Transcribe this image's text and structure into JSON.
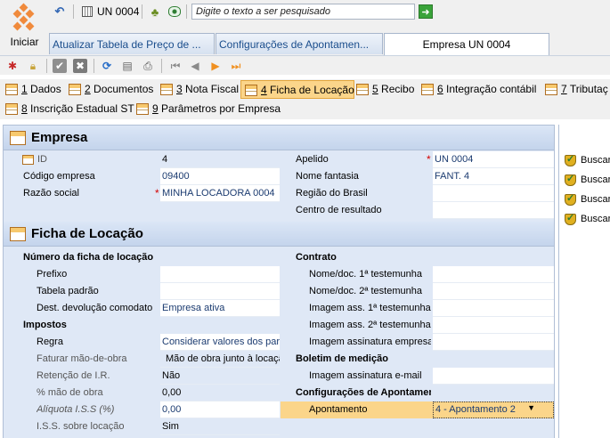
{
  "start": {
    "label": "Iniciar"
  },
  "toolbar": {
    "company_code": "UN 0004",
    "search_placeholder": "Digite o texto a ser pesquisado"
  },
  "tabs": [
    {
      "label": "Atualizar Tabela de Preço de ..."
    },
    {
      "label": "Configurações de Apontamen..."
    },
    {
      "label": "Empresa UN 0004"
    }
  ],
  "sections_nav": [
    {
      "num": "1",
      "label": "Dados"
    },
    {
      "num": "2",
      "label": "Documentos"
    },
    {
      "num": "3",
      "label": "Nota Fiscal"
    },
    {
      "num": "4",
      "label": "Ficha de Locação"
    },
    {
      "num": "5",
      "label": "Recibo"
    },
    {
      "num": "6",
      "label": "Integração contábil"
    },
    {
      "num": "7",
      "label": "Tributaç"
    },
    {
      "num": "8",
      "label": "Inscrição Estadual ST"
    },
    {
      "num": "9",
      "label": "Parâmetros por Empresa"
    }
  ],
  "empresa": {
    "title": "Empresa",
    "id_label": "ID",
    "id_value": "4",
    "codigo_label": "Código empresa",
    "codigo_value": "09400",
    "razao_label": "Razão social",
    "razao_value": "MINHA LOCADORA 0004",
    "apelido_label": "Apelido",
    "apelido_value": "UN 0004",
    "fantasia_label": "Nome fantasia",
    "fantasia_value": "FANT. 4",
    "regiao_label": "Região do Brasil",
    "regiao_value": "",
    "centro_label": "Centro de resultado",
    "centro_value": ""
  },
  "ficha": {
    "title": "Ficha de Locação",
    "numero_label": "Número da ficha de locação",
    "prefixo_label": "Prefixo",
    "prefixo_value": "",
    "tabela_label": "Tabela padrão",
    "tabela_value": "",
    "dest_label": "Dest. devolução comodato",
    "dest_value": "Empresa ativa",
    "impostos_label": "Impostos",
    "regra_label": "Regra",
    "regra_value": "Considerar valores dos par",
    "faturar_label": "Faturar mão-de-obra",
    "faturar_value": "Mão de obra junto à locaçã",
    "retencao_label": "Retenção de I.R.",
    "retencao_value": "Não",
    "pct_mao_label": "% mão de obra",
    "pct_mao_value": "0,00",
    "aliquota_label": "Alíquota I.S.S (%)",
    "aliquota_value": "0,00",
    "iss_label": "I.S.S. sobre locação",
    "iss_value": "Sim",
    "contrato_label": "Contrato",
    "test1_label": "Nome/doc. 1ª testemunha",
    "test1_value": "",
    "test2_label": "Nome/doc. 2ª testemunha",
    "test2_value": "",
    "img1_label": "Imagem ass. 1ª testemunha",
    "img1_value": "",
    "img2_label": "Imagem ass. 2ª testemunha",
    "img2_value": "",
    "imgemp_label": "Imagem assinatura empresa",
    "imgemp_value": "",
    "boletim_label": "Boletim de medição",
    "imgmail_label": "Imagem assinatura e-mail",
    "imgmail_value": "",
    "config_label": "Configurações de Apontamento",
    "apont_label": "Apontamento",
    "apont_value": "4 - Apontamento 2"
  },
  "right_panel": {
    "buscar_labels": [
      "Buscar",
      "Buscar",
      "Buscar",
      "Buscar"
    ]
  },
  "colors": {
    "accent": "#fbd58a",
    "panel": "#dfe8f6",
    "required": "#d40000"
  }
}
